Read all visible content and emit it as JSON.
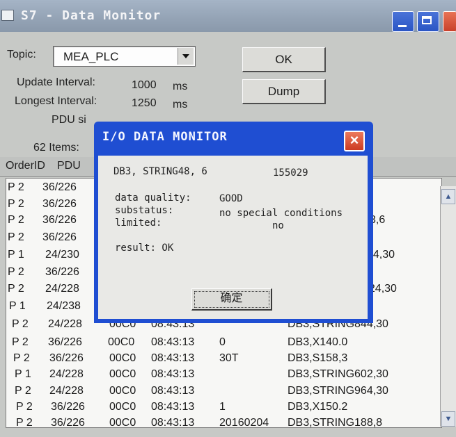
{
  "window": {
    "title": "S7 - Data Monitor"
  },
  "topic": {
    "label": "Topic:",
    "value": "MEA_PLC"
  },
  "buttons": {
    "ok": "OK",
    "dump": "Dump"
  },
  "stats": {
    "update_label": "Update Interval:",
    "update_value": "1000",
    "update_unit": "ms",
    "longest_label": "Longest Interval:",
    "longest_value": "1250",
    "longest_unit": "ms",
    "pdu_label": "PDU si"
  },
  "items": {
    "count": "62 Items:"
  },
  "columns": {
    "order": "OrderID",
    "pdu": "PDU"
  },
  "rows": [
    {
      "order": "P 2",
      "pdu": "36/226",
      "c3": "",
      "time": "",
      "val": "",
      "addr": ""
    },
    {
      "order": "P 2",
      "pdu": "36/226",
      "c3": "",
      "time": "",
      "val": "",
      "addr": ""
    },
    {
      "order": "P 2",
      "pdu": "36/226",
      "c3": "",
      "time": "",
      "val": "",
      "addr": "3,6"
    },
    {
      "order": "P 2",
      "pdu": "36/226",
      "c3": "",
      "time": "",
      "val": "",
      "addr": ""
    },
    {
      "order": "P 1",
      "pdu": "24/230",
      "c3": "",
      "time": "",
      "val": "",
      "addr": "24,30"
    },
    {
      "order": "P 2",
      "pdu": "36/226",
      "c3": "",
      "time": "",
      "val": "",
      "addr": ""
    },
    {
      "order": "P 2",
      "pdu": "24/228",
      "c3": "",
      "time": "",
      "val": "",
      "addr": "024,30"
    },
    {
      "order": "P 1",
      "pdu": "24/238",
      "c3": "",
      "time": "",
      "val": "",
      "addr": ""
    },
    {
      "order": "P 2",
      "pdu": "24/228",
      "c3": "00C0",
      "time": "08:43:13",
      "val": "",
      "addr": "DB3,STRING844,30"
    },
    {
      "order": "P 2",
      "pdu": "36/226",
      "c3": "00C0",
      "time": "08:43:13",
      "val": "0",
      "addr": "DB3,X140.0"
    },
    {
      "order": "P 2",
      "pdu": "36/226",
      "c3": "00C0",
      "time": "08:43:13",
      "val": "30T",
      "addr": "DB3,S158,3"
    },
    {
      "order": "P 1",
      "pdu": "24/228",
      "c3": "00C0",
      "time": "08:43:13",
      "val": "",
      "addr": "DB3,STRING602,30"
    },
    {
      "order": "P 2",
      "pdu": "24/228",
      "c3": "00C0",
      "time": "08:43:13",
      "val": "",
      "addr": "DB3,STRING964,30"
    },
    {
      "order": "P 2",
      "pdu": "36/226",
      "c3": "00C0",
      "time": "08:43:13",
      "val": "1",
      "addr": "DB3,X150.2"
    },
    {
      "order": "P 2",
      "pdu": "36/226",
      "c3": "00C0",
      "time": "08:43:13",
      "val": "20160204",
      "addr": "DB3,STRING188,8"
    }
  ],
  "dialog": {
    "title": "I/O DATA MONITOR",
    "item": "DB3, STRING48, 6",
    "value": "155029",
    "quality_label": "data quality:",
    "quality_value": "GOOD",
    "substatus_label": "substatus:",
    "substatus_value": "no special conditions",
    "limited_label": "limited:",
    "limited_value": "no",
    "result": "result: OK",
    "ok": "确定"
  },
  "icons": {
    "close": "close-icon",
    "minimize": "minimize-icon",
    "maximize": "maximize-icon"
  }
}
